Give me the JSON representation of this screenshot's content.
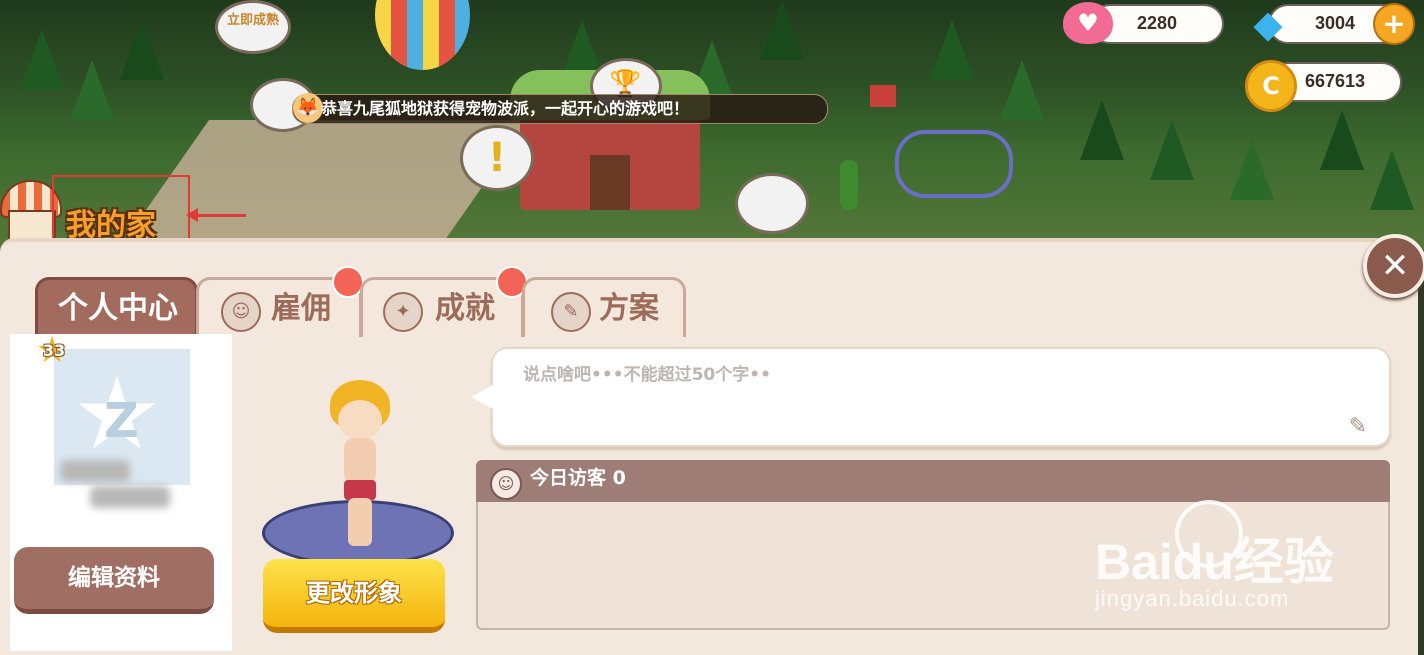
{
  "resources": {
    "hearts": "2280",
    "diamonds": "3004",
    "coins": "667613"
  },
  "announcement": "恭喜九尾狐地狱获得宠物波派，一起开心的游戏吧！",
  "scene": {
    "bubble_tag": "立即成熟"
  },
  "home": {
    "title": "我的家"
  },
  "tabs": [
    {
      "label": "个人中心",
      "active": true
    },
    {
      "label": "雇佣",
      "badge": true
    },
    {
      "label": "成就",
      "badge": true
    },
    {
      "label": "方案",
      "badge": false
    }
  ],
  "profile": {
    "level": "33",
    "edit_button": "编辑资料",
    "change_look_button": "更改形象"
  },
  "message": {
    "placeholder": "说点啥吧•••不能超过50个字••"
  },
  "visitors": {
    "label": "今日访客 0"
  },
  "watermark": {
    "brand": "Baidu经验",
    "url": "jingyan.baidu.com"
  },
  "colors": {
    "panel_bg": "#f3e8dd",
    "tab_active": "#a26b5e",
    "button_yellow": "#f4b40c",
    "highlight": "#e33838"
  }
}
